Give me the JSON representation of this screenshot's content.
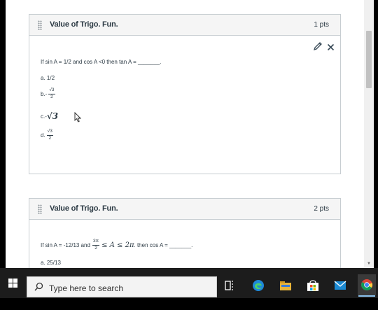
{
  "questions": [
    {
      "title": "Value of Trigo. Fun.",
      "points": "1 pts",
      "text": "If sin A = 1/2 and cos A <0 then tan A = _______.",
      "answers": [
        {
          "prefix": "a. 1/2"
        },
        {
          "prefix": "b.-",
          "num": "√3",
          "den": "2"
        },
        {
          "prefix": "c.-",
          "expr": "√3"
        },
        {
          "prefix": "d.",
          "num": "√3",
          "den": "2"
        }
      ]
    },
    {
      "title": "Value of Trigo. Fun.",
      "points": "2 pts",
      "text_pre": "If sin A = -12/13 and",
      "frac_num": "3π",
      "frac_den": "2",
      "text_mid": "≤ A ≤ 2π",
      "text_post": ". then cos A = _______.",
      "answers": [
        {
          "prefix": "a. 25/13"
        }
      ]
    }
  ],
  "taskbar": {
    "search_placeholder": "Type here to search"
  },
  "icons": [
    "start-windows-icon",
    "search-magnifier-icon",
    "task-view-icon",
    "edge-browser-icon",
    "file-explorer-icon",
    "microsoft-store-icon",
    "mail-icon",
    "chrome-icon",
    "pencil-icon",
    "close-icon",
    "drag-handle-icon",
    "mouse-cursor-icon"
  ],
  "colors": {
    "taskbar": "#1c1c1c",
    "header_bg": "#f5f5f5",
    "border": "#c7cdd1",
    "text": "#2d3b45"
  }
}
